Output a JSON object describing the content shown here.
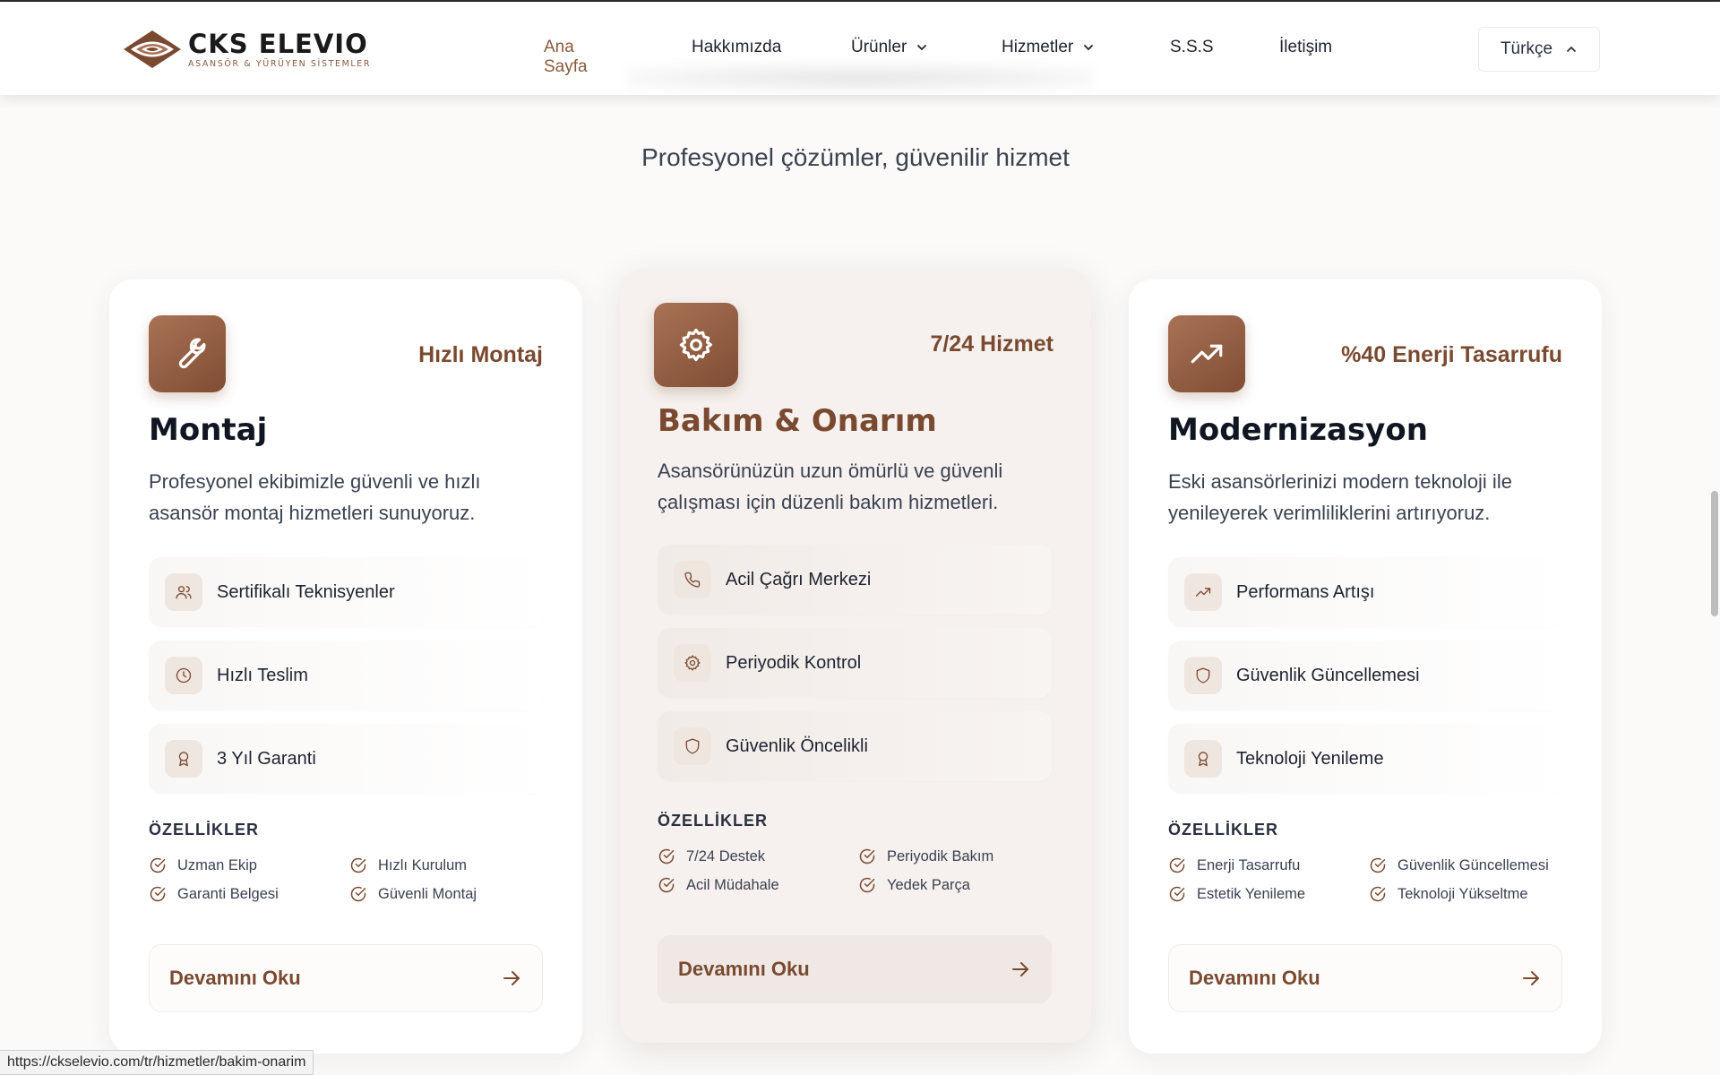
{
  "header": {
    "logo": {
      "name_part1": "CKS",
      "name_part2": "ELEVIO",
      "tagline": "ASANSÖR & YÜRÜYEN SİSTEMLER"
    },
    "nav": [
      {
        "label": "Ana Sayfa",
        "active": true
      },
      {
        "label": "Hakkımızda"
      },
      {
        "label": "Ürünler",
        "dropdown": true
      },
      {
        "label": "Hizmetler",
        "dropdown": true
      },
      {
        "label": "S.S.S"
      },
      {
        "label": "İletişim"
      }
    ],
    "language": "Türkçe"
  },
  "subtitle": "Profesyonel çözümler, güvenilir hizmet",
  "cards": [
    {
      "icon": "wrench-icon",
      "badge": "Hızlı Montaj",
      "title": "Montaj",
      "description": "Profesyonel ekibimizle güvenli ve hızlı asansör montaj hizmetleri sunuyoruz.",
      "features": [
        {
          "icon": "users-icon",
          "label": "Sertifikalı Teknisyenler"
        },
        {
          "icon": "clock-icon",
          "label": "Hızlı Teslim"
        },
        {
          "icon": "award-icon",
          "label": "3 Yıl Garanti"
        }
      ],
      "specs_heading": "ÖZELLİKLER",
      "specs": [
        "Uzman Ekip",
        "Hızlı Kurulum",
        "Garanti Belgesi",
        "Güvenli Montaj"
      ],
      "button": "Devamını Oku"
    },
    {
      "icon": "gear-icon",
      "badge": "7/24 Hizmet",
      "title": "Bakım & Onarım",
      "description": "Asansörünüzün uzun ömürlü ve güvenli çalışması için düzenli bakım hizmetleri.",
      "features": [
        {
          "icon": "phone-icon",
          "label": "Acil Çağrı Merkezi"
        },
        {
          "icon": "gear-icon",
          "label": "Periyodik Kontrol"
        },
        {
          "icon": "shield-icon",
          "label": "Güvenlik Öncelikli"
        }
      ],
      "specs_heading": "ÖZELLİKLER",
      "specs": [
        "7/24 Destek",
        "Periyodik Bakım",
        "Acil Müdahale",
        "Yedek Parça"
      ],
      "button": "Devamını Oku"
    },
    {
      "icon": "trending-up-icon",
      "badge": "%40 Enerji Tasarrufu",
      "title": "Modernizasyon",
      "description": "Eski asansörlerinizi modern teknoloji ile yenileyerek verimliliklerini artırıyoruz.",
      "features": [
        {
          "icon": "trending-up-icon",
          "label": "Performans Artışı"
        },
        {
          "icon": "shield-icon",
          "label": "Güvenlik Güncellemesi"
        },
        {
          "icon": "award-icon",
          "label": "Teknoloji Yenileme"
        }
      ],
      "specs_heading": "ÖZELLİKLER",
      "specs": [
        "Enerji Tasarrufu",
        "Güvenlik Güncellemesi",
        "Estetik Yenileme",
        "Teknoloji Yükseltme"
      ],
      "button": "Devamını Oku"
    }
  ],
  "status_url": "https://ckselevio.com/tr/hizmetler/bakim-onarim",
  "colors": {
    "accent": "#7a4a30",
    "accent_light": "#a97255",
    "text": "#1e2330"
  }
}
